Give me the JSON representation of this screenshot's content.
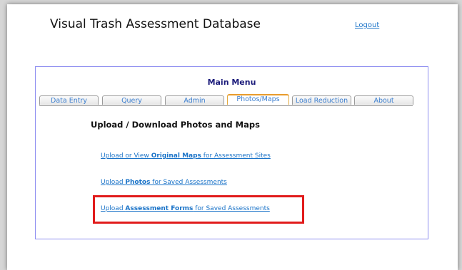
{
  "app": {
    "title": "Visual Trash Assessment Database",
    "logout_label": "Logout"
  },
  "menu": {
    "header": "Main Menu",
    "tabs": [
      {
        "label": "Data Entry",
        "active": false
      },
      {
        "label": "Query",
        "active": false
      },
      {
        "label": "Admin",
        "active": false
      },
      {
        "label": "Photos/Maps",
        "active": true
      },
      {
        "label": "Load Reduction",
        "active": false
      },
      {
        "label": "About",
        "active": false
      }
    ]
  },
  "content": {
    "heading": "Upload / Download Photos and Maps",
    "links": [
      {
        "pre": "Upload or View ",
        "bold": "Original Maps",
        "post": " for Assessment Sites"
      },
      {
        "pre": "Upload ",
        "bold": "Photos",
        "post": " for Saved Assessments"
      },
      {
        "pre": "Upload ",
        "bold": "Assessment Forms",
        "post": " for Saved Assessments"
      }
    ]
  },
  "colors": {
    "link": "#1a73c8",
    "active_tab_accent": "#e89b2c",
    "panel_border": "#8e8ef0",
    "highlight": "#e11b1b"
  }
}
